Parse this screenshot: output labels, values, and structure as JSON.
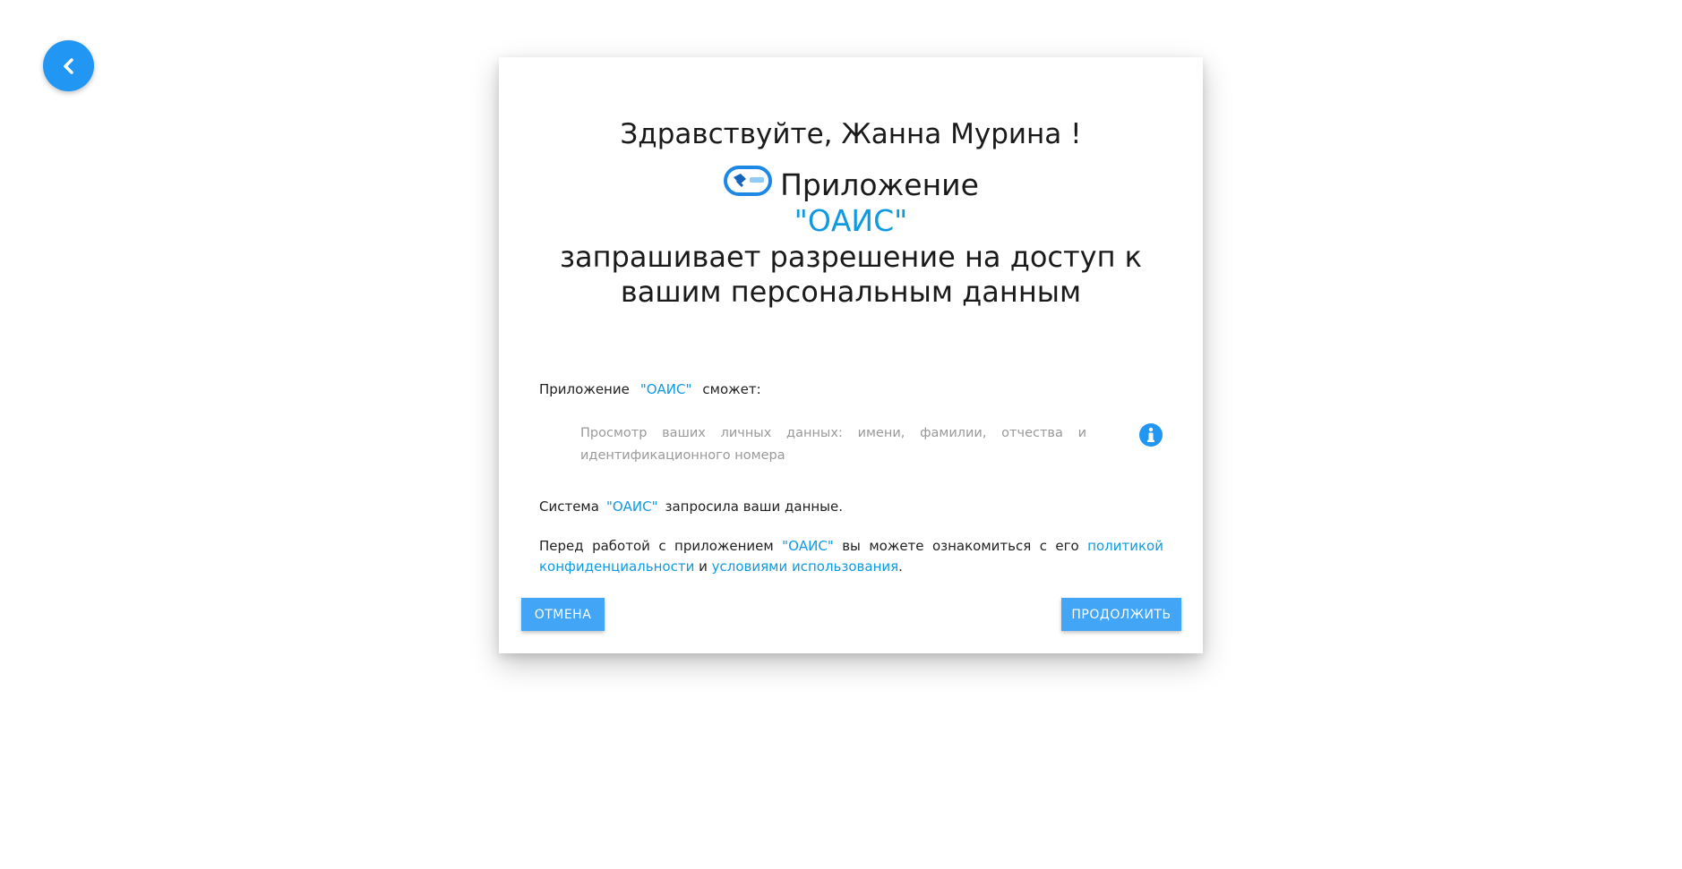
{
  "dialog": {
    "greeting": "Здравствуйте, Жанна Мурина !",
    "app_label": "Приложение",
    "app_name": "\"ОАИС\"",
    "request_text": "запрашивает разрешение на доступ к вашим персональным данным",
    "can_prefix": "Приложение",
    "can_app_name": "\"ОАИС\"",
    "can_suffix": "сможет:",
    "permission_text": "Просмотр ваших личных данных: имени, фамилии, отчества и идентификационного номера",
    "system_prefix": "Система",
    "system_app_name": "\"ОАИС\"",
    "system_suffix": "запросила ваши данные.",
    "policy_prefix": "Перед работой с приложением",
    "policy_app_name": "\"ОАИС\"",
    "policy_middle": "вы можете ознакомиться с его",
    "policy_link": "политикой конфиденциальности",
    "policy_and": "и",
    "terms_link": "условиями использования",
    "policy_end": ".",
    "cancel_label": "ОТМЕНА",
    "continue_label": "ПРОДОЛЖИТЬ"
  },
  "colors": {
    "accent": "#2196f3",
    "button": "#42a5f5",
    "link": "#0f9ae0"
  },
  "icons": {
    "back": "chevron-left-icon",
    "logo": "app-logo-icon",
    "info": "info-icon"
  }
}
